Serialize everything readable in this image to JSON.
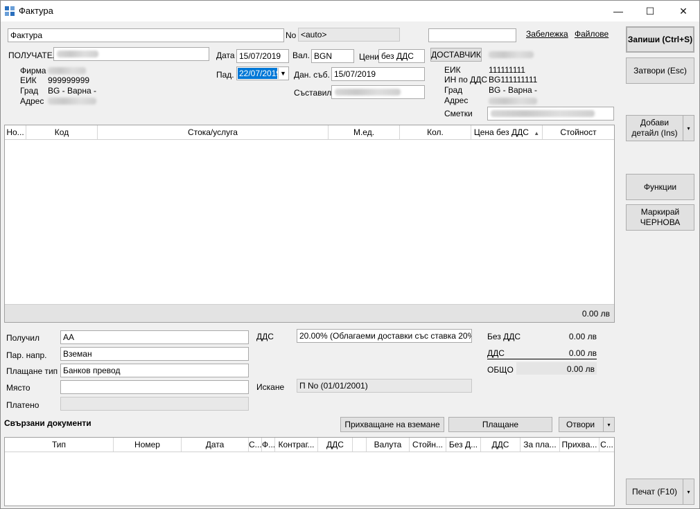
{
  "window": {
    "title": "Фактура",
    "minimize": "—",
    "maximize": "☐",
    "close": "✕"
  },
  "header": {
    "doc_type_value": "Фактура",
    "no_label": "No",
    "no_value": "<auto>",
    "note_link": "Забележка",
    "files_link": "Файлове",
    "recipient_label": "ПОЛУЧАТЕЛ",
    "date_label": "Дата",
    "date_value": "15/07/2019",
    "currency_label": "Вал.",
    "currency_value": "BGN",
    "prices_label": "Цени",
    "prices_value": "без ДДС",
    "supplier_button": "ДОСТАВЧИК",
    "due_label": "Пад.",
    "due_value": "22/07/2019",
    "tax_date_label": "Дан. съб.",
    "tax_date_value": "15/07/2019",
    "compiled_label": "Съставил"
  },
  "recipient": {
    "company_label": "Фирма",
    "eik_label": "ЕИК",
    "eik_value": "999999999",
    "city_label": "Град",
    "city_value": "BG - Варна -",
    "address_label": "Адрес"
  },
  "supplier": {
    "eik_label": "ЕИК",
    "eik_value": "111111111",
    "vat_label": "ИН по ДДС",
    "vat_value": "BG111111111",
    "city_label": "Град",
    "city_value": "BG - Варна -",
    "address_label": "Адрес",
    "accounts_label": "Сметки"
  },
  "items_grid": {
    "columns": [
      "Но...",
      "Код",
      "Стока/услуга",
      "М.ед.",
      "Кол.",
      "Цена без ДДС",
      "Стойност"
    ],
    "sort_icon": "▲",
    "total": "0.00 лв"
  },
  "bottom": {
    "received_label": "Получил",
    "received_value": "АА",
    "payment_dir_label": "Пар. напр.",
    "payment_dir_value": "Вземан",
    "payment_type_label": "Плащане тип",
    "payment_type_value": "Банков превод",
    "place_label": "Място",
    "paid_label": "Платено",
    "vat_label": "ДДС",
    "vat_value": "20.00% (Облагаеми доставки със ставка 20%)",
    "request_label": "Искане",
    "request_value": "П No     (01/01/2001)",
    "sum_without_vat_label": "Без ДДС",
    "sum_without_vat_value": "0.00 лв",
    "sum_vat_label": "ДДС",
    "sum_vat_value": "0.00 лв",
    "sum_total_label": "ОБЩО",
    "sum_total_value": "0.00 лв"
  },
  "linked": {
    "title": "Свързани документи",
    "attach_button": "Прихващане на вземане",
    "payment_button": "Плащане",
    "open_button": "Отвори",
    "columns": [
      "Тип",
      "Номер",
      "Дата",
      "С...",
      "Ф...",
      "Контраг...",
      "ДДС",
      "",
      "Валута",
      "Стойн...",
      "Без Д...",
      "ДДС",
      "За пла...",
      "Прихва...",
      "С..."
    ]
  },
  "side_buttons": {
    "save": "Запиши (Ctrl+S)",
    "close": "Затвори (Esc)",
    "add_detail_line1": "Добави",
    "add_detail_line2": "детайл (Ins)",
    "functions": "Функции",
    "mark_line1": "Маркирай",
    "mark_line2": "ЧЕРНОВА",
    "print": "Печат (F10)",
    "dropdown_arrow": "▾"
  }
}
